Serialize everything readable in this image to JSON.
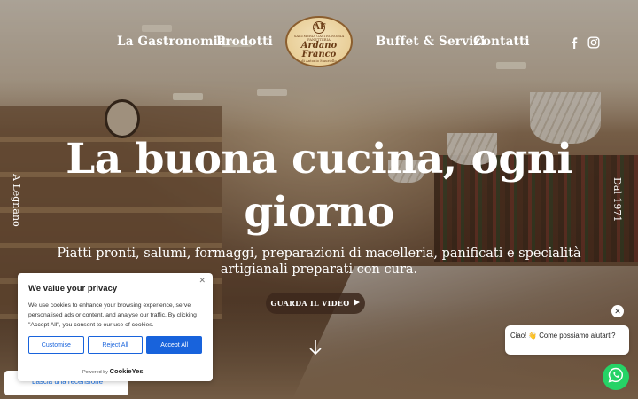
{
  "nav": {
    "left": [
      "La Gastronomia",
      "Prodotti"
    ],
    "right": [
      "Buffet & Servizi",
      "Contatti"
    ],
    "social": [
      "facebook-icon",
      "instagram-icon"
    ]
  },
  "logo": {
    "monogram": "AF",
    "top_text": "SALUMERIA GASTRONOMIA",
    "top_text2": "PANETTERIA",
    "script": "Ardano Franco",
    "bottom_text": "di Antonio Mauriello"
  },
  "side": {
    "left": "A Legnano",
    "right": "Dal 1971"
  },
  "hero": {
    "headline": "La buona cucina, ogni giorno",
    "subline": "Piatti pronti, salumi, formaggi, preparazioni di macelleria, panificati e specialità artigianali preparati con cura.",
    "video_button": "GUARDA IL VIDEO"
  },
  "review": {
    "link": "Lascia una recensione"
  },
  "cookie": {
    "title": "We value your privacy",
    "body": "We use cookies to enhance your browsing experience, serve personalised ads or content, and analyse our traffic. By clicking \"Accept All\", you consent to our use of cookies.",
    "customise": "Customise",
    "reject": "Reject All",
    "accept": "Accept All",
    "powered_by": "Powered by",
    "brand": "CookieYes"
  },
  "chat": {
    "message": "Ciao! 👋 Come possiamo aiutarti?"
  },
  "colors": {
    "accept_blue": "#1863dc",
    "whatsapp_green": "#25d366",
    "video_button": "#3c281c"
  }
}
